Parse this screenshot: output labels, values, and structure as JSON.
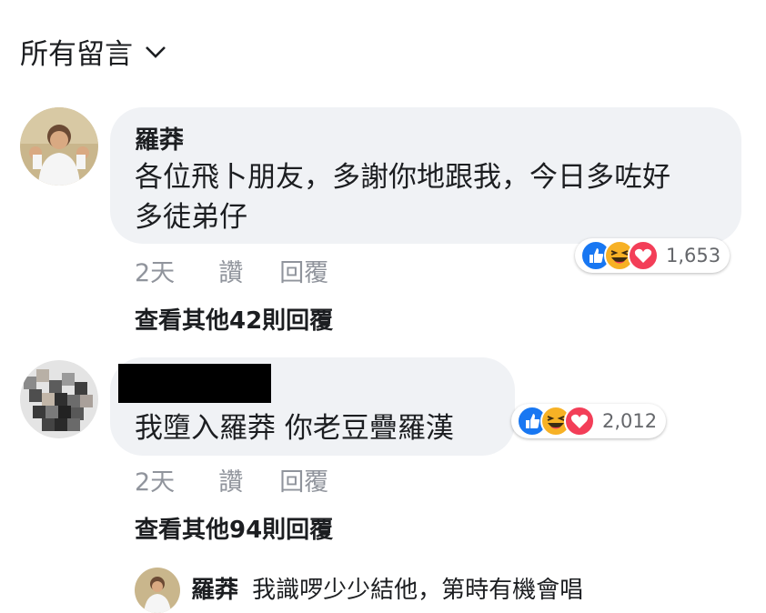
{
  "header": {
    "filter_label": "所有留言",
    "icon": "chevron-down-icon"
  },
  "comments": [
    {
      "author": "羅莽",
      "text_line1": "各位飛卜朋友，多謝你地跟我，今日多咗好",
      "text_line2": "多徒弟仔",
      "time": "2天",
      "like_label": "讚",
      "reply_label": "回覆",
      "reaction_count": "1,653",
      "reactions": [
        "like",
        "haha",
        "love"
      ],
      "view_more": "查看其他42則回覆"
    },
    {
      "author": "",
      "text": "我墮入羅莽 你老豆疊羅漢",
      "time": "2天",
      "like_label": "讚",
      "reply_label": "回覆",
      "reaction_count": "2,012",
      "reactions": [
        "like",
        "haha",
        "love"
      ],
      "view_more": "查看其他94則回覆"
    }
  ],
  "partial_comment": {
    "author": "羅莽",
    "text": "我識啰少少結他，第時有機會唱"
  },
  "colors": {
    "like": "#1877f2",
    "haha": "#f7b125",
    "love": "#f33e58",
    "bubble": "#f0f2f5",
    "meta": "#90949c"
  }
}
